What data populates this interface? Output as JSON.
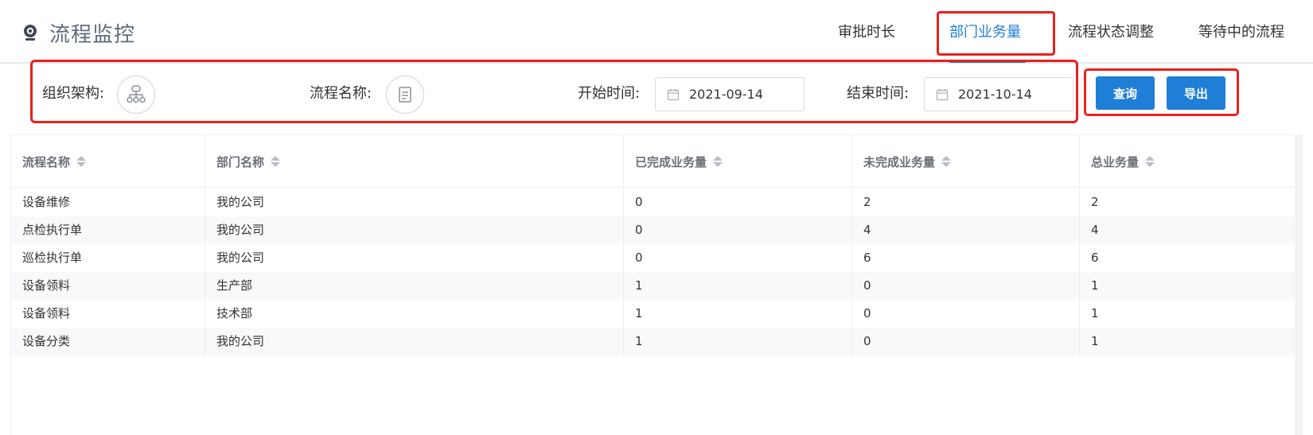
{
  "header": {
    "title": "流程监控",
    "title_icon": "webcam-icon",
    "tabs": [
      {
        "label": "审批时长",
        "active": false
      },
      {
        "label": "部门业务量",
        "active": true
      },
      {
        "label": "流程状态调整",
        "active": false
      },
      {
        "label": "等待中的流程",
        "active": false
      }
    ],
    "accent_color": "#1f7fd6",
    "highlight_color": "#e8211d"
  },
  "filters": {
    "org_label": "组织架构:",
    "org_icon": "org-chart-icon",
    "process_label": "流程名称:",
    "process_icon": "document-icon",
    "start_label": "开始时间:",
    "start_value": "2021-09-14",
    "end_label": "结束时间:",
    "end_value": "2021-10-14",
    "query_button": "查询",
    "export_button": "导出"
  },
  "table": {
    "columns": [
      "流程名称",
      "部门名称",
      "已完成业务量",
      "未完成业务量",
      "总业务量"
    ],
    "rows": [
      [
        "设备维修",
        "我的公司",
        "0",
        "2",
        "2"
      ],
      [
        "点检执行单",
        "我的公司",
        "0",
        "4",
        "4"
      ],
      [
        "巡检执行单",
        "我的公司",
        "0",
        "6",
        "6"
      ],
      [
        "设备领料",
        "生产部",
        "1",
        "0",
        "1"
      ],
      [
        "设备领料",
        "技术部",
        "1",
        "0",
        "1"
      ],
      [
        "设备分类",
        "我的公司",
        "1",
        "0",
        "1"
      ]
    ]
  }
}
